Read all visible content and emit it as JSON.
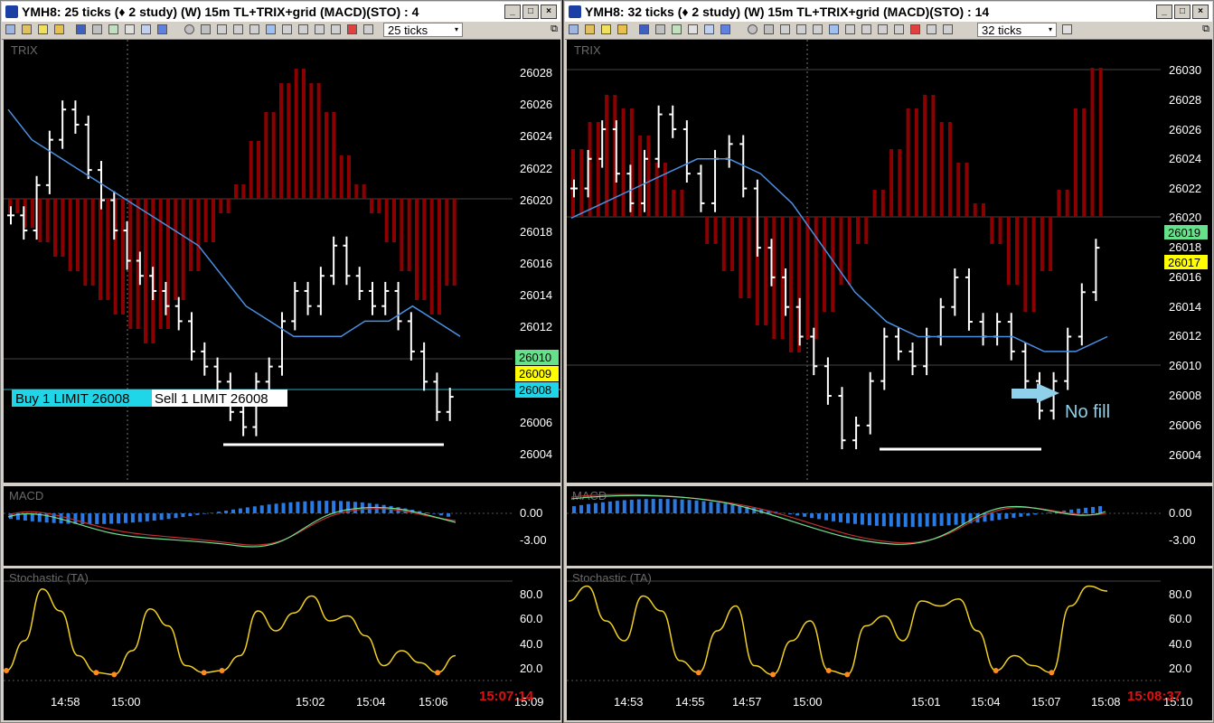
{
  "windows": [
    {
      "id": "left",
      "title": "YMH8: 25 ticks (♦ 2 study) (W) 15m TL+TRIX+grid (MACD)(STO) : 4",
      "tick_selector": "25 ticks",
      "clock": "15:07:14",
      "x_time_labels": [
        "14:58",
        "15:00",
        "15:02",
        "15:04",
        "15:06",
        "15:09"
      ],
      "price_pane": {
        "label": "TRIX",
        "y_ticks": [
          "26028",
          "26026",
          "26024",
          "26022",
          "26020",
          "26018",
          "26016",
          "26014",
          "26012",
          "26010",
          "26008",
          "26006",
          "26004"
        ],
        "price_tags": [
          {
            "text": "26010",
            "color": "#66e08a"
          },
          {
            "text": "26009",
            "color": "#ffff00"
          },
          {
            "text": "26008",
            "color": "#1ed6e8"
          }
        ],
        "order_labels": [
          {
            "text": "Buy 1 LIMIT 26008",
            "bg": "#1ed6e8"
          },
          {
            "text": "Sell 1 LIMIT 26008",
            "bg": "#ffffff"
          }
        ]
      },
      "macd_pane": {
        "label": "MACD",
        "y_ticks": [
          "0.00",
          "-3.00"
        ]
      },
      "stoch_pane": {
        "label": "Stochastic (TA)",
        "y_ticks": [
          "80.0",
          "60.0",
          "40.0",
          "20.0"
        ]
      }
    },
    {
      "id": "right",
      "title": "YMH8: 32 ticks (♦ 2 study) (W) 15m TL+TRIX+grid (MACD)(STO) : 14",
      "tick_selector": "32 ticks",
      "clock": "15:08:37",
      "x_time_labels": [
        "14:53",
        "14:55",
        "14:57",
        "15:00",
        "15:01",
        "15:04",
        "15:07",
        "15:08",
        "15:10"
      ],
      "price_pane": {
        "label": "TRIX",
        "y_ticks": [
          "26030",
          "26028",
          "26026",
          "26024",
          "26022",
          "26020",
          "26018",
          "26016",
          "26014",
          "26012",
          "26010",
          "26008",
          "26006",
          "26004"
        ],
        "price_tags": [
          {
            "text": "26019",
            "color": "#66e08a"
          },
          {
            "text": "26017",
            "color": "#ffff00"
          }
        ],
        "annotation": "No fill"
      },
      "macd_pane": {
        "label": "MACD",
        "y_ticks": [
          "0.00",
          "-3.00"
        ]
      },
      "stoch_pane": {
        "label": "Stochastic (TA)",
        "y_ticks": [
          "80.0",
          "60.0",
          "40.0",
          "20.0"
        ]
      }
    }
  ],
  "chart_data": [
    {
      "type": "line",
      "window": "left",
      "panel": "price",
      "description_series": [
        "Price (tick bars)",
        "TRIX moving average",
        "TRIX histogram"
      ],
      "x_labels": [
        "14:58",
        "15:00",
        "15:02",
        "15:04",
        "15:06"
      ],
      "ylim": [
        26003,
        26029
      ],
      "series": [
        {
          "values": [
            26019,
            26018,
            26021,
            26024,
            26026,
            26025,
            26022,
            26020,
            26018,
            26016,
            26015,
            26014,
            26013,
            26012,
            26010,
            26009,
            26008,
            26006,
            26005,
            26008,
            26009,
            26012,
            26014,
            26013,
            26015,
            26017,
            26015,
            26014,
            26013,
            26014,
            26012,
            26010,
            26008,
            26006,
            26007
          ]
        },
        {
          "values": [
            26026,
            26024,
            26023,
            26022,
            26021,
            26020,
            26019,
            26018,
            26017,
            26015,
            26013,
            26012,
            26011,
            26011,
            26011,
            26012,
            26012,
            26013,
            26012,
            26011
          ]
        },
        {
          "values": [
            -1,
            -2,
            -3,
            -4,
            -5,
            -6,
            -7,
            -8,
            -9,
            -10,
            -9,
            -7,
            -5,
            -3,
            -1,
            1,
            4,
            6,
            8,
            9,
            8,
            6,
            3,
            1,
            -1,
            -3,
            -5,
            -7,
            -8,
            -6
          ]
        }
      ]
    },
    {
      "type": "line",
      "window": "left",
      "panel": "stochastic",
      "x_labels": [
        "14:58",
        "15:00",
        "15:02",
        "15:04",
        "15:06"
      ],
      "ylim": [
        0,
        100
      ],
      "series": [
        {
          "values": [
            10,
            40,
            92,
            70,
            25,
            8,
            6,
            30,
            72,
            55,
            15,
            8,
            10,
            25,
            70,
            50,
            68,
            85,
            60,
            65,
            45,
            15,
            30,
            18,
            8,
            25
          ]
        }
      ]
    },
    {
      "type": "line",
      "window": "right",
      "panel": "price",
      "x_labels": [
        "14:53",
        "14:55",
        "14:57",
        "15:00",
        "15:01",
        "15:04",
        "15:07",
        "15:08"
      ],
      "ylim": [
        26003,
        26031
      ],
      "series": [
        {
          "values": [
            26022,
            26024,
            26026,
            26023,
            26021,
            26024,
            26027,
            26026,
            26023,
            26021,
            26024,
            26025,
            26022,
            26018,
            26016,
            26014,
            26012,
            26010,
            26008,
            26005,
            26006,
            26009,
            26012,
            26011,
            26010,
            26012,
            26014,
            26016,
            26013,
            26012,
            26013,
            26011,
            26009,
            26007,
            26009,
            26012,
            26015,
            26018
          ]
        },
        {
          "values": [
            26020,
            26021,
            26022,
            26023,
            26024,
            26024,
            26023,
            26021,
            26018,
            26015,
            26013,
            26012,
            26012,
            26012,
            26012,
            26011,
            26011,
            26012
          ]
        },
        {
          "values": [
            5,
            7,
            9,
            8,
            6,
            4,
            2,
            0,
            -2,
            -4,
            -6,
            -8,
            -9,
            -10,
            -9,
            -7,
            -5,
            -2,
            2,
            5,
            8,
            9,
            7,
            4,
            1,
            -2,
            -5,
            -7,
            -4,
            2,
            8,
            11
          ]
        }
      ]
    },
    {
      "type": "line",
      "window": "right",
      "panel": "stochastic",
      "x_labels": [
        "14:53",
        "14:55",
        "14:57",
        "15:00",
        "15:01",
        "15:04",
        "15:07",
        "15:08"
      ],
      "ylim": [
        0,
        100
      ],
      "series": [
        {
          "values": [
            80,
            95,
            60,
            40,
            85,
            70,
            20,
            8,
            50,
            75,
            15,
            6,
            40,
            60,
            10,
            6,
            55,
            65,
            40,
            80,
            75,
            82,
            50,
            10,
            25,
            15,
            8,
            75,
            95,
            90
          ]
        }
      ]
    }
  ]
}
